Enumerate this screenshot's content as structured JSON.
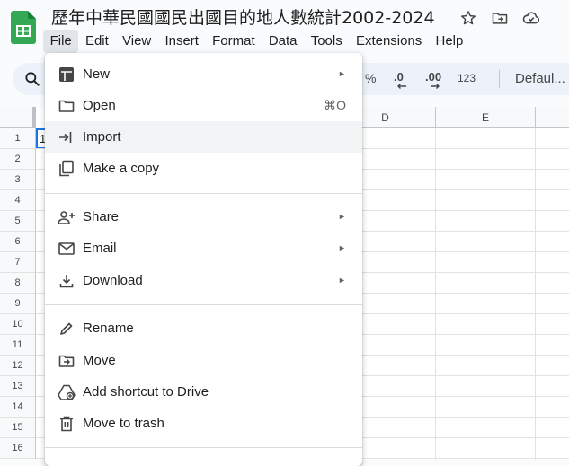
{
  "app": {
    "title": "歷年中華民國國民出國目的地人數統計2002-2024",
    "icons": [
      "sheets-logo-icon",
      "star-icon",
      "move-to-folder-icon",
      "cloud-saved-icon"
    ]
  },
  "menubar": {
    "items": [
      "File",
      "Edit",
      "View",
      "Insert",
      "Format",
      "Data",
      "Tools",
      "Extensions",
      "Help"
    ],
    "active": "File"
  },
  "toolbar": {
    "percent_label": "%",
    "decrease_decimal_label": ".0",
    "increase_decimal_label": ".00",
    "number_format_label": "123",
    "font_label": "Defaul..."
  },
  "grid": {
    "columns": [
      "D",
      "E"
    ],
    "rows": [
      "1",
      "2",
      "3",
      "4",
      "5",
      "6",
      "7",
      "8",
      "9",
      "10",
      "11",
      "12",
      "13",
      "14",
      "15",
      "16"
    ],
    "a1_partial": "1"
  },
  "file_menu": {
    "items": [
      {
        "label": "New",
        "icon": "new-sheet-icon",
        "submenu": true
      },
      {
        "label": "Open",
        "icon": "folder-icon",
        "shortcut": "⌘O"
      },
      {
        "label": "Import",
        "icon": "import-icon",
        "highlighted": true
      },
      {
        "label": "Make a copy",
        "icon": "copy-icon"
      },
      {
        "label": "Share",
        "icon": "share-person-icon",
        "submenu": true
      },
      {
        "label": "Email",
        "icon": "email-icon",
        "submenu": true
      },
      {
        "label": "Download",
        "icon": "download-icon",
        "submenu": true
      },
      {
        "label": "Rename",
        "icon": "pencil-icon"
      },
      {
        "label": "Move",
        "icon": "move-folder-icon"
      },
      {
        "label": "Add shortcut to Drive",
        "icon": "drive-shortcut-icon"
      },
      {
        "label": "Move to trash",
        "icon": "trash-icon"
      }
    ],
    "submenu_arrow": "►"
  },
  "colors": {
    "accent": "#1a73e8",
    "sheets_green": "#188038",
    "toolbar_bg": "#edf2fa",
    "menu_hover": "#f1f3f4"
  }
}
